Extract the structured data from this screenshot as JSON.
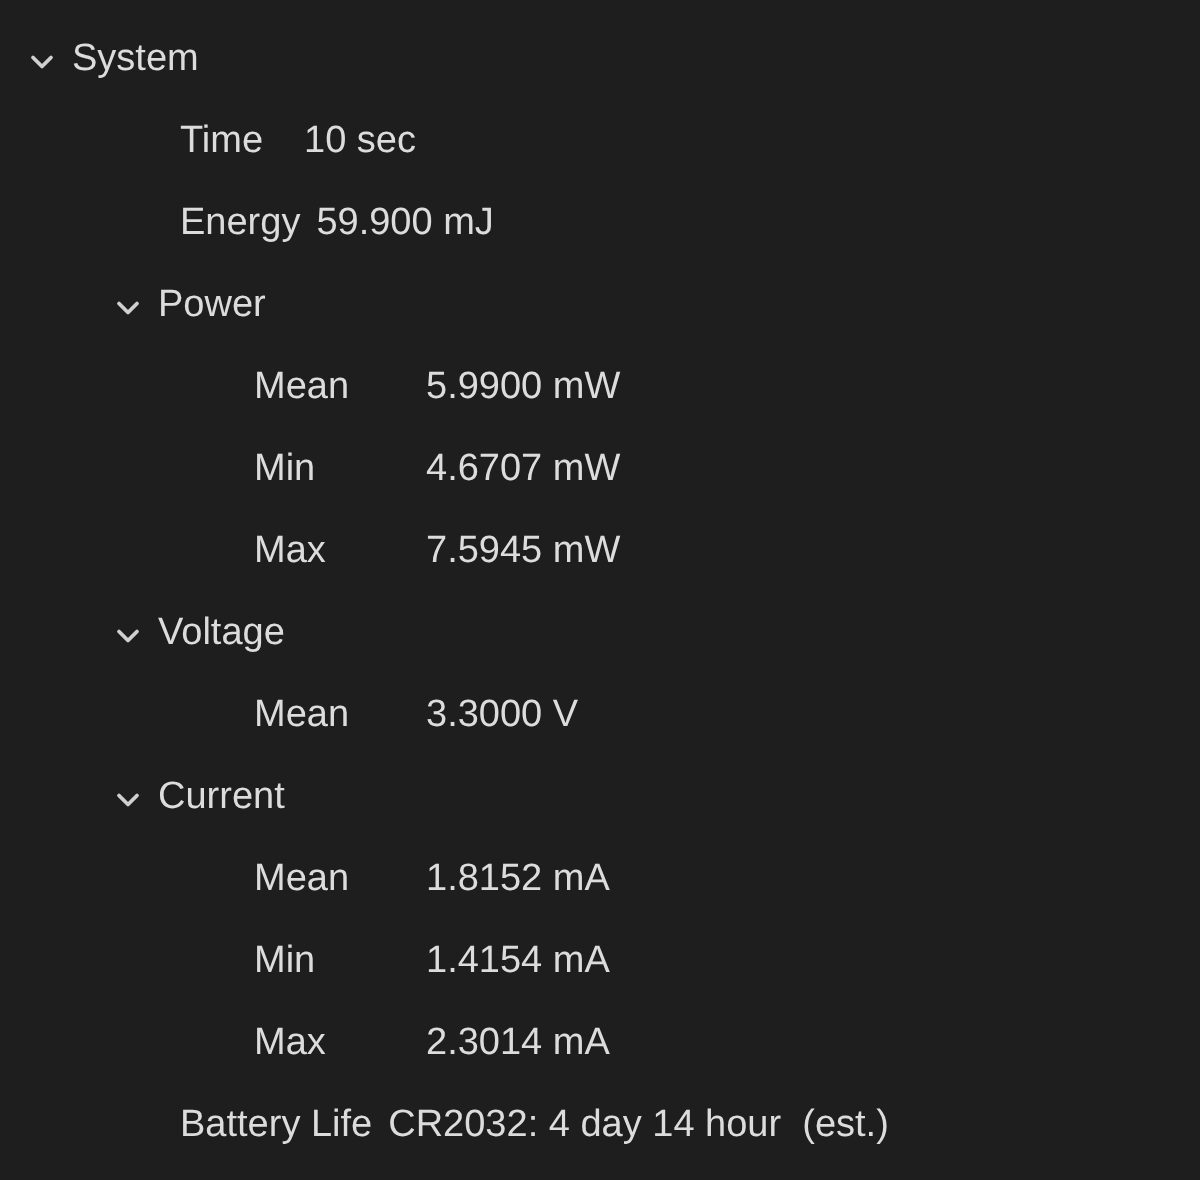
{
  "tree": [
    {
      "label": "System",
      "expanded": true,
      "children": [
        {
          "label": "Time",
          "value": "10 sec"
        },
        {
          "label": "Energy",
          "value": "59.900 mJ"
        },
        {
          "label": "Power",
          "expanded": true,
          "children": [
            {
              "label": "Mean",
              "value": "5.9900 mW"
            },
            {
              "label": "Min",
              "value": "4.6707 mW"
            },
            {
              "label": "Max",
              "value": "7.5945 mW"
            }
          ]
        },
        {
          "label": "Voltage",
          "expanded": true,
          "children": [
            {
              "label": "Mean",
              "value": "3.3000 V"
            }
          ]
        },
        {
          "label": "Current",
          "expanded": true,
          "children": [
            {
              "label": "Mean",
              "value": "1.8152 mA"
            },
            {
              "label": "Min",
              "value": "1.4154 mA"
            },
            {
              "label": "Max",
              "value": "2.3014 mA"
            }
          ]
        },
        {
          "label": "Battery Life",
          "value": "CR2032: 4 day 14 hour  (est.)"
        }
      ]
    }
  ]
}
